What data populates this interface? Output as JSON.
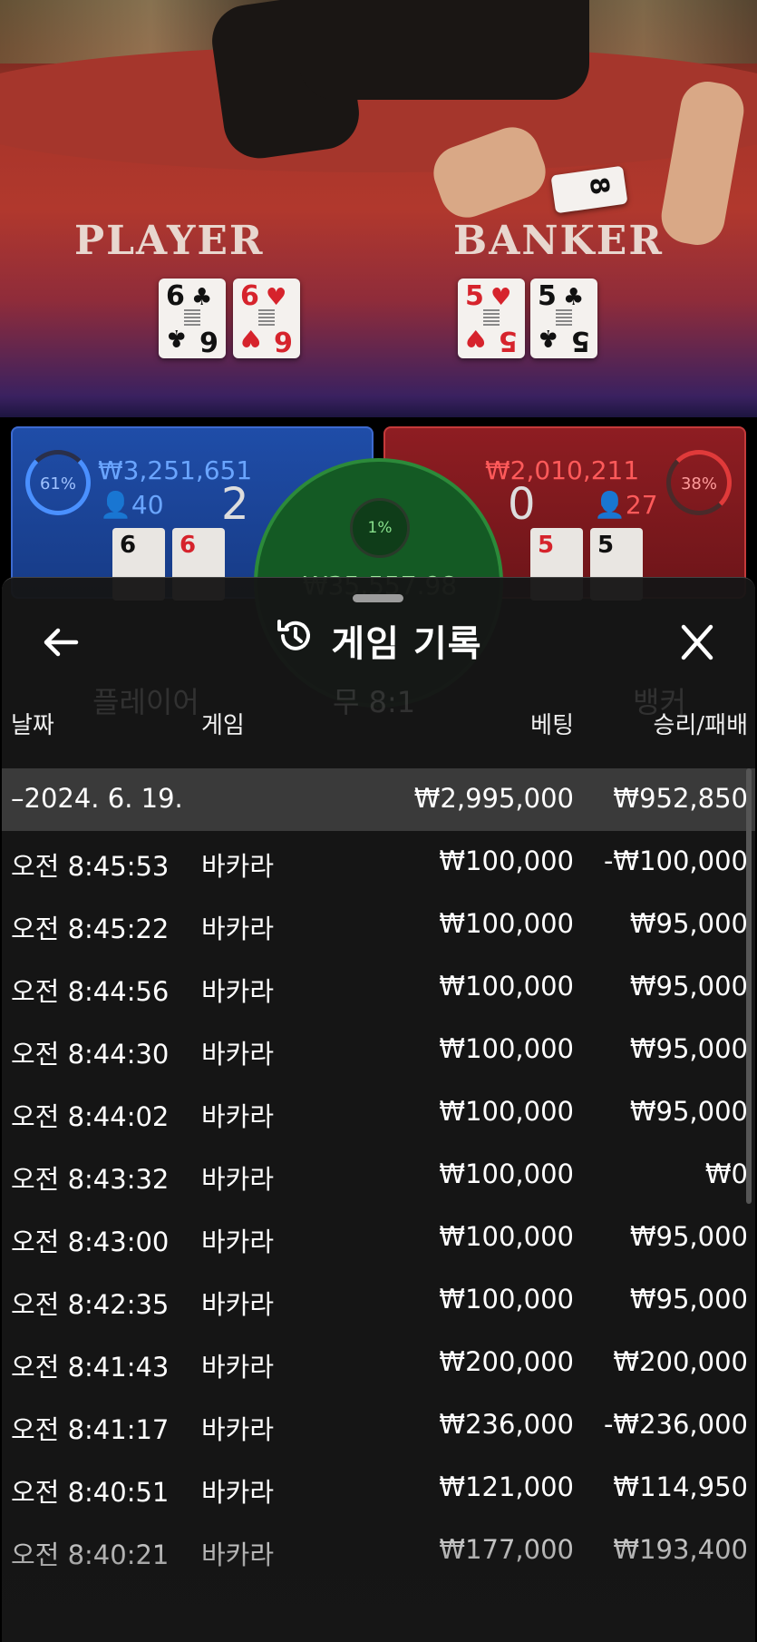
{
  "game_view": {
    "player_label": "PLAYER",
    "banker_label": "BANKER",
    "player_cards": [
      {
        "rank": "6",
        "suit": "♣",
        "color": "black"
      },
      {
        "rank": "6",
        "suit": "♥",
        "color": "red"
      }
    ],
    "banker_cards": [
      {
        "rank": "5",
        "suit": "♥",
        "color": "red"
      },
      {
        "rank": "5",
        "suit": "♣",
        "color": "black"
      }
    ],
    "dealer_card": {
      "rank": "8",
      "suit": "♠"
    }
  },
  "hud": {
    "player": {
      "percent": "61%",
      "amount": "₩3,251,651",
      "players": "40",
      "score": "2",
      "color": "#4a90ff"
    },
    "banker": {
      "percent": "38%",
      "amount": "₩2,010,211",
      "players": "27",
      "score": "0",
      "color": "#e03a3a"
    },
    "tie": {
      "percent": "1%",
      "amount": "₩35,557.98",
      "color": "#7fe07f"
    }
  },
  "background_ghost": {
    "player_label": "플레이어",
    "tie_label": "무 8:1",
    "banker_label": "뱅커"
  },
  "sheet": {
    "title": "게임 기록",
    "back_icon": "arrow-left-icon",
    "history_icon": "history-icon",
    "close_icon": "close-icon",
    "columns": {
      "date": "날짜",
      "game": "게임",
      "bet": "베팅",
      "result": "승리/패배"
    },
    "date_row": {
      "date": "–2024. 6. 19.",
      "bet": "₩2,995,000",
      "result": "₩952,850"
    },
    "rows": [
      {
        "time": "오전 8:45:53",
        "game": "바카라",
        "bet": "₩100,000",
        "result": "-₩100,000"
      },
      {
        "time": "오전 8:45:22",
        "game": "바카라",
        "bet": "₩100,000",
        "result": "₩95,000"
      },
      {
        "time": "오전 8:44:56",
        "game": "바카라",
        "bet": "₩100,000",
        "result": "₩95,000"
      },
      {
        "time": "오전 8:44:30",
        "game": "바카라",
        "bet": "₩100,000",
        "result": "₩95,000"
      },
      {
        "time": "오전 8:44:02",
        "game": "바카라",
        "bet": "₩100,000",
        "result": "₩95,000"
      },
      {
        "time": "오전 8:43:32",
        "game": "바카라",
        "bet": "₩100,000",
        "result": "₩0"
      },
      {
        "time": "오전 8:43:00",
        "game": "바카라",
        "bet": "₩100,000",
        "result": "₩95,000"
      },
      {
        "time": "오전 8:42:35",
        "game": "바카라",
        "bet": "₩100,000",
        "result": "₩95,000"
      },
      {
        "time": "오전 8:41:43",
        "game": "바카라",
        "bet": "₩200,000",
        "result": "₩200,000"
      },
      {
        "time": "오전 8:41:17",
        "game": "바카라",
        "bet": "₩236,000",
        "result": "-₩236,000"
      },
      {
        "time": "오전 8:40:51",
        "game": "바카라",
        "bet": "₩121,000",
        "result": "₩114,950"
      },
      {
        "time": "오전 8:40:21",
        "game": "바카라",
        "bet": "₩177,000",
        "result": "₩193,400"
      }
    ]
  }
}
